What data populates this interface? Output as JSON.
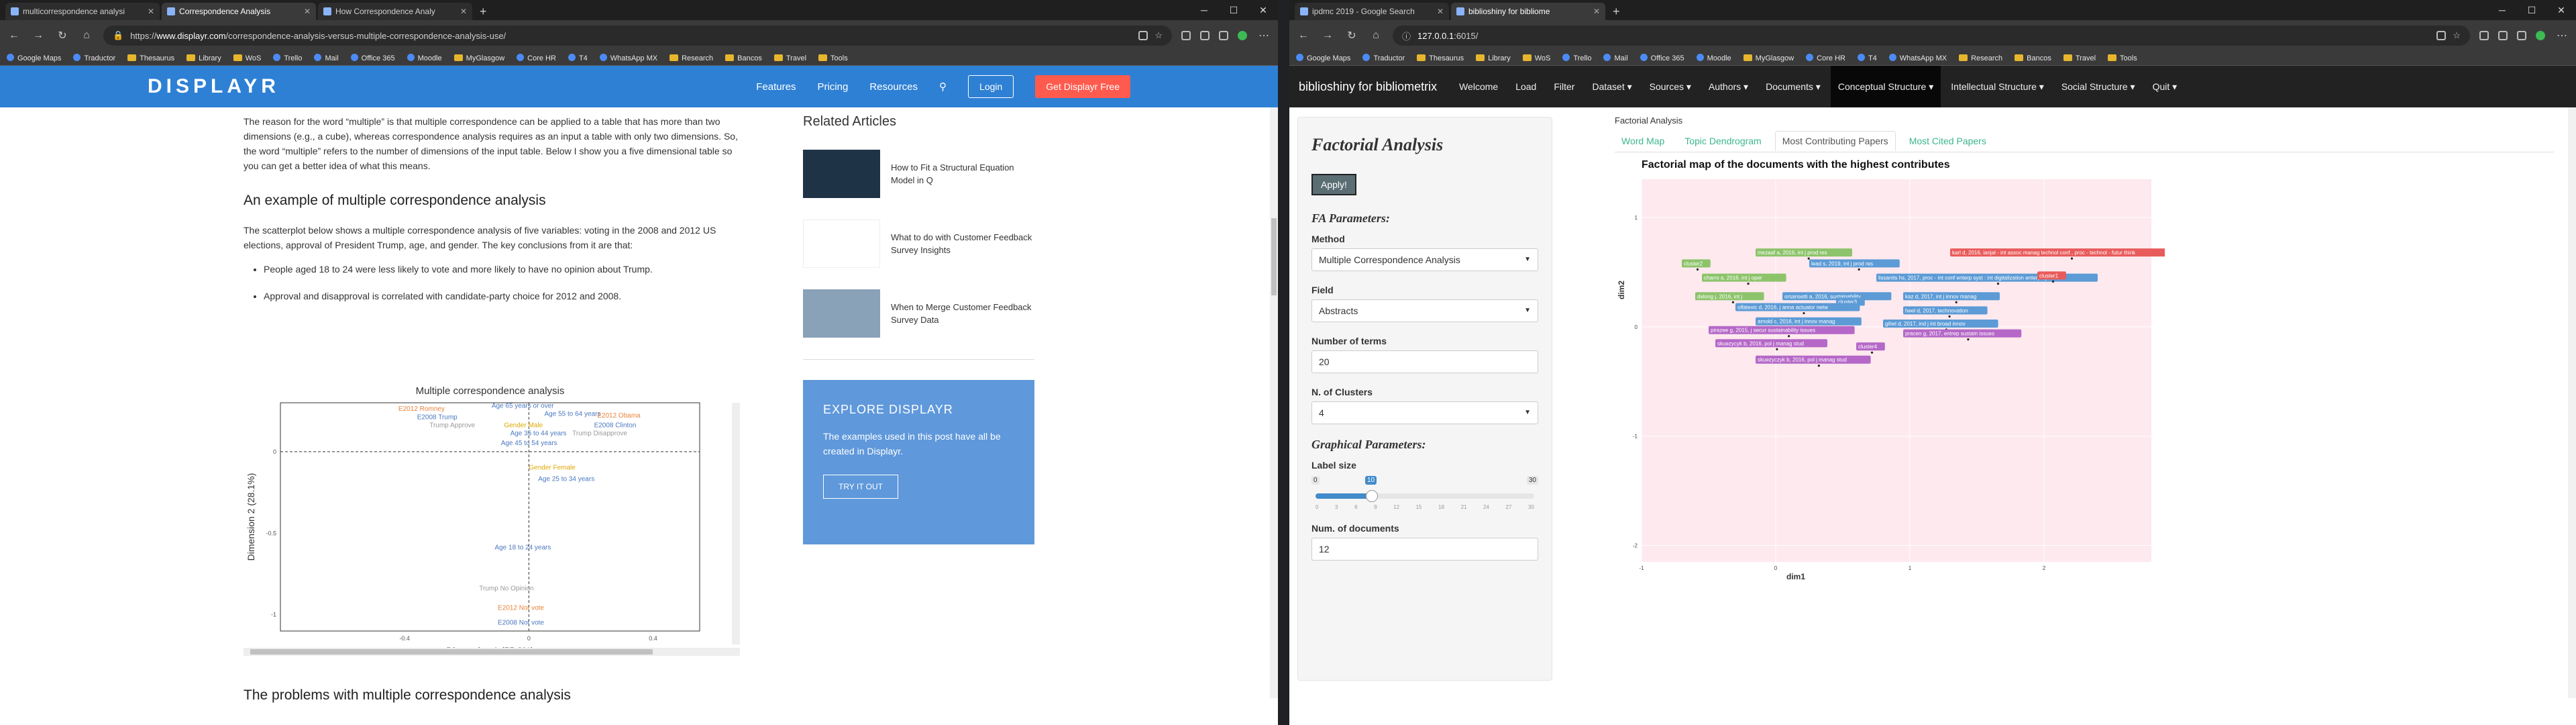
{
  "left": {
    "tabs": [
      {
        "title": "multicorrespondence analysi",
        "active": false
      },
      {
        "title": "Correspondence Analysis",
        "active": true
      },
      {
        "title": "How Correspondence Analy",
        "active": false
      }
    ],
    "url_prefix": "https://",
    "url_host": "www.displayr.com",
    "url_path": "/correspondence-analysis-versus-multiple-correspondence-analysis-use/",
    "bookmarks": [
      "Google Maps",
      "Traductor",
      "Thesaurus",
      "Library",
      "WoS",
      "Trello",
      "Mail",
      "Office 365",
      "Moodle",
      "MyGlasgow",
      "Core HR",
      "T4",
      "WhatsApp MX",
      "Research",
      "Bancos",
      "Travel",
      "Tools"
    ],
    "site": {
      "logo": "DISPLAYR",
      "nav": [
        "Features",
        "Pricing",
        "Resources"
      ],
      "login": "Login",
      "cta": "Get Displayr Free"
    },
    "article": {
      "intro": "The reason for the word “multiple” is that multiple correspondence can be applied to a table that has more than two dimensions (e.g., a cube), whereas correspondence analysis requires as an input a table with only two dimensions. So, the word “multiple” refers to the number of dimensions of the input table. Below I show you a five dimensional table so you can get a better idea of what this means.",
      "heading": "An example of multiple correspondence analysis",
      "para": "The scatterplot below shows a multiple correspondence analysis of five variables: voting in the 2008 and 2012 US elections, approval of President Trump, age, and gender. The key conclusions from it are that:",
      "bullets": [
        "People aged 18 to 24 were less likely to vote and more likely to have no opinion about Trump.",
        "Approval and disapproval is correlated with candidate-party choice for 2012 and 2008."
      ],
      "next_heading": "The problems with multiple correspondence analysis"
    },
    "chart_data": {
      "type": "scatter",
      "title": "Multiple correspondence analysis",
      "xlabel": "Dimension 1 (55.8%)",
      "ylabel": "Dimension 2 (28.1%)",
      "xlim": [
        -0.8,
        0.55
      ],
      "ylim": [
        -1.1,
        0.3
      ],
      "xticks": [
        -0.4,
        0,
        0.4
      ],
      "xtick_labels": [
        "-0.4",
        "0",
        "0.4"
      ],
      "yticks": [
        0,
        -0.5,
        -1
      ],
      "ytick_labels": [
        "0",
        "-0.5",
        "-1"
      ],
      "points": [
        {
          "label": "E2012 Romney",
          "x": -0.42,
          "y": 0.25,
          "color": "#e8833a"
        },
        {
          "label": "Age 65 years or over",
          "x": -0.12,
          "y": 0.27,
          "color": "#4a78c2"
        },
        {
          "label": "E2008 Trump",
          "x": -0.36,
          "y": 0.2,
          "color": "#4a78c2"
        },
        {
          "label": "Trump Approve",
          "x": -0.32,
          "y": 0.15,
          "color": "#999999"
        },
        {
          "label": "Age 55 to 64 years",
          "x": 0.05,
          "y": 0.22,
          "color": "#4a78c2"
        },
        {
          "label": "E2012 Obama",
          "x": 0.22,
          "y": 0.21,
          "color": "#e8833a"
        },
        {
          "label": "Gender Male",
          "x": -0.08,
          "y": 0.15,
          "color": "#e0a800"
        },
        {
          "label": "E2008 Clinton",
          "x": 0.21,
          "y": 0.15,
          "color": "#4a78c2"
        },
        {
          "label": "Age 35 to 44 years",
          "x": -0.06,
          "y": 0.1,
          "color": "#4a78c2"
        },
        {
          "label": "Trump Disapprove",
          "x": 0.14,
          "y": 0.1,
          "color": "#999999"
        },
        {
          "label": "Age 45 to 54 years",
          "x": -0.09,
          "y": 0.04,
          "color": "#4a78c2"
        },
        {
          "label": "Gender Female",
          "x": 0.0,
          "y": -0.11,
          "color": "#e0a800"
        },
        {
          "label": "Age 25 to 34 years",
          "x": 0.03,
          "y": -0.18,
          "color": "#4a78c2"
        },
        {
          "label": "Age 18 to 24 years",
          "x": -0.11,
          "y": -0.6,
          "color": "#4a78c2"
        },
        {
          "label": "Trump No Opinion",
          "x": -0.16,
          "y": -0.85,
          "color": "#999999"
        },
        {
          "label": "E2012 Not vote",
          "x": -0.1,
          "y": -0.97,
          "color": "#e8833a"
        },
        {
          "label": "E2008 Not vote",
          "x": -0.1,
          "y": -1.06,
          "color": "#4a78c2"
        }
      ]
    },
    "related": {
      "title": "Related Articles",
      "items": [
        "How to Fit a Structural Equation Model in Q",
        "What to do with Customer Feedback Survey Insights",
        "When to Merge Customer Feedback Survey Data"
      ]
    },
    "explore": {
      "title": "EXPLORE DISPLAYR",
      "text": "The examples used in this post have all be created in Displayr.",
      "button": "TRY IT OUT"
    }
  },
  "right": {
    "tabs": [
      {
        "title": "ipdmc 2019 - Google Search",
        "active": false
      },
      {
        "title": "biblioshiny for bibliome",
        "active": true
      }
    ],
    "url_host": "127.0.0.1",
    "url_port": ":6015/",
    "bookmarks": [
      "Google Maps",
      "Traductor",
      "Thesaurus",
      "Library",
      "WoS",
      "Trello",
      "Mail",
      "Office 365",
      "Moodle",
      "MyGlasgow",
      "Core HR",
      "T4",
      "WhatsApp MX",
      "Research",
      "Bancos",
      "Travel",
      "Tools"
    ],
    "app": {
      "brand": "biblioshiny for bibliometrix",
      "menu": [
        "Welcome",
        "Load",
        "Filter",
        "Dataset ▾",
        "Sources ▾",
        "Authors ▾",
        "Documents ▾",
        "Conceptual Structure ▾",
        "Intellectual Structure ▾",
        "Social Structure ▾",
        "Quit ▾"
      ],
      "active_menu": 7
    },
    "panel": {
      "title": "Factorial Analysis",
      "apply": "Apply!",
      "fa_params": "FA Parameters:",
      "method_label": "Method",
      "method_value": "Multiple Correspondence Analysis",
      "field_label": "Field",
      "field_value": "Abstracts",
      "terms_label": "Number of terms",
      "terms_value": "20",
      "clusters_label": "N. of Clusters",
      "clusters_value": "4",
      "graph_params": "Graphical Parameters:",
      "labelsize_label": "Label size",
      "labelsize_min": "0",
      "labelsize_max": "30",
      "labelsize_value": "10",
      "labelsize_fraction": 0.333,
      "labelsize_ticks": [
        "0",
        "3",
        "6",
        "9",
        "12",
        "15",
        "18",
        "21",
        "24",
        "27",
        "30"
      ],
      "docs_label": "Num. of documents",
      "docs_value": "12"
    },
    "main": {
      "breadcrumb": "Factorial Analysis",
      "tabs": [
        "Word Map",
        "Topic Dendrogram",
        "Most Contributing Papers",
        "Most Cited Papers"
      ],
      "active_tab": 2
    },
    "chart_data": {
      "type": "scatter",
      "title": "Factorial map of the documents with the highest contributes",
      "xlabel": "dim1",
      "ylabel": "dim2",
      "xlim": [
        -1,
        2.8
      ],
      "ylim": [
        -2.15,
        1.35
      ],
      "xticks": [
        -1,
        0,
        1,
        2
      ],
      "yticks": [
        1,
        0,
        -1,
        -2
      ],
      "clusters": [
        {
          "name": "cluster1",
          "color": "#e95b5b"
        },
        {
          "name": "cluster2",
          "color": "#8dc46b"
        },
        {
          "name": "cluster3",
          "color": "#5c9bd6"
        },
        {
          "name": "cluster4",
          "color": "#b568c8"
        }
      ],
      "points": [
        {
          "label": "mezaaf a, 2016, int j prod res",
          "x": -0.15,
          "y": 0.68,
          "cluster": 1
        },
        {
          "label": "karl d, 2016, ianjal - int assoc manag technol conf , proc - technol - futur think",
          "x": 1.3,
          "y": 0.68,
          "cluster": 0
        },
        {
          "label": "lead s, 2019, int j prod res",
          "x": 0.25,
          "y": 0.58,
          "cluster": 2
        },
        {
          "label": "cluster2",
          "x": -0.7,
          "y": 0.58,
          "cluster": 1
        },
        {
          "label": "charro a, 2016, int j oper",
          "x": -0.55,
          "y": 0.45,
          "cluster": 1
        },
        {
          "label": "lissanits hs, 2017, proc - int conf enterp syst : int digitalization enterp system",
          "x": 0.75,
          "y": 0.45,
          "cluster": 2
        },
        {
          "label": "cluster1",
          "x": 1.95,
          "y": 0.47,
          "cluster": 0
        },
        {
          "label": "delong j, 2016, int j",
          "x": -0.6,
          "y": 0.28,
          "cluster": 1
        },
        {
          "label": "orsansetti a, 2016, sustainability",
          "x": 0.05,
          "y": 0.28,
          "cluster": 2
        },
        {
          "label": "kaz d, 2017, int j innov manag",
          "x": 0.95,
          "y": 0.28,
          "cluster": 2
        },
        {
          "label": "cluster3",
          "x": 0.45,
          "y": 0.23,
          "cluster": 2
        },
        {
          "label": "olfatevic d, 2016, j anna actuator netw",
          "x": -0.3,
          "y": 0.18,
          "cluster": 2
        },
        {
          "label": "heel d, 2017, technovation",
          "x": 0.95,
          "y": 0.15,
          "cluster": 2
        },
        {
          "label": "arnold c, 2016, int j innov manag",
          "x": -0.15,
          "y": 0.05,
          "cluster": 2
        },
        {
          "label": "gihel d, 2017, ind j int broad innov",
          "x": 0.8,
          "y": 0.03,
          "cluster": 2
        },
        {
          "label": "pirazee g, 2015, j secur sustainability issues",
          "x": -0.5,
          "y": -0.03,
          "cluster": 3
        },
        {
          "label": "pracen g, 2017, entrep sustain issues",
          "x": 0.95,
          "y": -0.06,
          "cluster": 3
        },
        {
          "label": "skuezycyk b, 2016, pol j manag stud",
          "x": -0.45,
          "y": -0.15,
          "cluster": 3
        },
        {
          "label": "cluster4",
          "x": 0.6,
          "y": -0.18,
          "cluster": 3
        },
        {
          "label": "skuezyczyk b, 2016, pol j manag stud",
          "x": -0.15,
          "y": -0.3,
          "cluster": 3
        }
      ]
    }
  }
}
